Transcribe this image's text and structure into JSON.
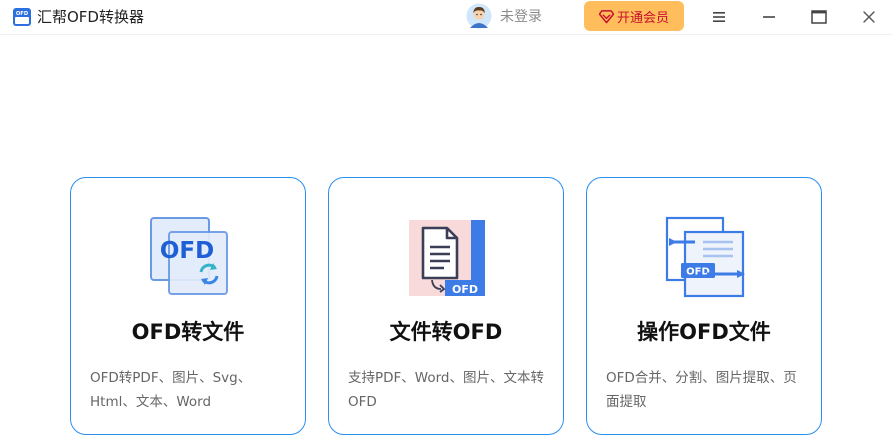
{
  "app": {
    "title": "汇帮OFD转换器",
    "logo_icon": "ofd-logo-icon"
  },
  "header": {
    "avatar_icon": "user-avatar-icon",
    "login_label": "未登录",
    "vip_label": "开通会员",
    "vip_icon": "diamond-icon"
  },
  "window_controls": {
    "menu_icon": "menu-icon",
    "minimize_icon": "minimize-icon",
    "maximize_icon": "maximize-icon",
    "close_icon": "close-icon"
  },
  "colors": {
    "accent": "#2b8ff0",
    "vip_bg": "#ffbd5c",
    "vip_text": "#c8102e",
    "icon_blue": "#2e6fe0",
    "icon_pink": "#f9dada",
    "desc_text": "#666666"
  },
  "cards": [
    {
      "icon": "ofd-convert-icon",
      "title": "OFD转文件",
      "desc": "OFD转PDF、图片、Svg、Html、文本、Word",
      "icon_text": "OFD"
    },
    {
      "icon": "file-to-ofd-icon",
      "title": "文件转OFD",
      "desc": "支持PDF、Word、图片、文本转OFD",
      "icon_text": "OFD"
    },
    {
      "icon": "ofd-operate-icon",
      "title": "操作OFD文件",
      "desc": "OFD合并、分割、图片提取、页面提取",
      "icon_text": "OFD"
    }
  ]
}
